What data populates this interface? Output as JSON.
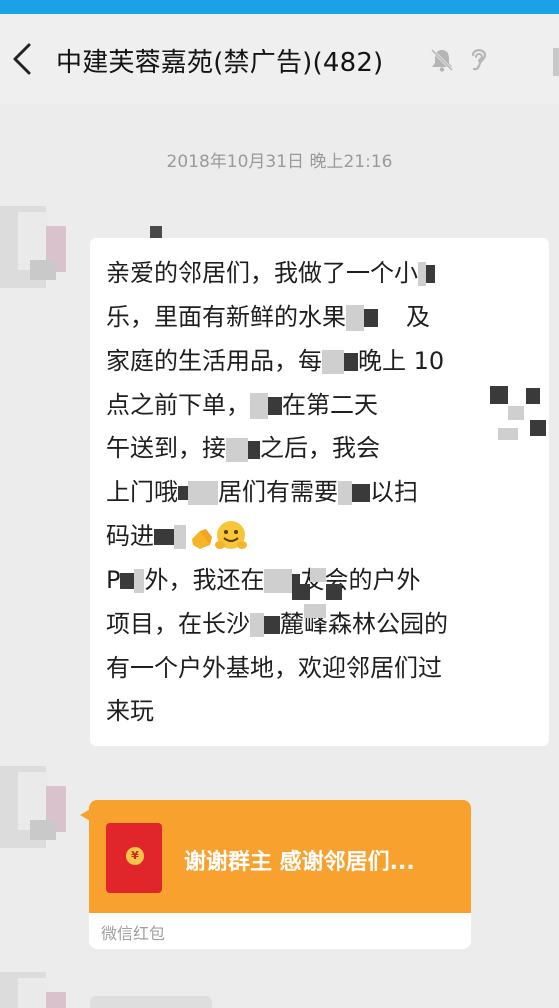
{
  "header": {
    "title": "中建芙蓉嘉苑(禁广告)(482)",
    "back_icon": "chevron-left",
    "mute_icon": "bell-slash",
    "voice_icon": "ear"
  },
  "chat": {
    "timestamp": "2018年10月31日 晚上21:16",
    "message": {
      "lines": [
        "亲爱的邻居们，我做了一个小",
        "乐，里面有新鲜的水果",
        "及",
        "家庭的生活用品，每",
        "晚上 10",
        "点之前下单，",
        "在第二天",
        "午送到，接",
        "之后，我会",
        "上门哦",
        "居们有需要",
        "以扫",
        "码进",
        "P",
        "外，我还在",
        "友会的户外",
        "项目，在长沙",
        "麓峰森林公园的",
        "有一个户外基地，欢迎邻居们过",
        "来玩"
      ]
    },
    "red_packet": {
      "text": "谢谢群主 感谢邻居们...",
      "label": "微信红包",
      "coin_symbol": "¥",
      "colors": {
        "card": "#f9a12f",
        "envelope": "#e0262b"
      }
    }
  },
  "colors": {
    "status_bar": "#1aa1e6",
    "background": "#ececec"
  }
}
